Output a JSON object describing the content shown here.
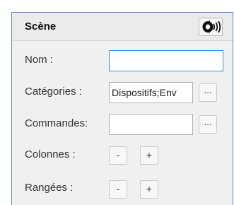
{
  "panel": {
    "title": "Scène",
    "broadcast_icon": "speaker-broadcast-icon"
  },
  "fields": {
    "nom": {
      "label": "Nom :",
      "value": ""
    },
    "categories": {
      "label": "Catégories :",
      "value": "Dispositifs;Env",
      "browse_label": "..."
    },
    "commandes": {
      "label": "Commandes:",
      "value": "",
      "browse_label": "..."
    },
    "colonnes": {
      "label": "Colonnes :",
      "minus_label": "-",
      "plus_label": "+"
    },
    "rangees": {
      "label": "Rangées :",
      "minus_label": "-",
      "plus_label": "+"
    }
  }
}
